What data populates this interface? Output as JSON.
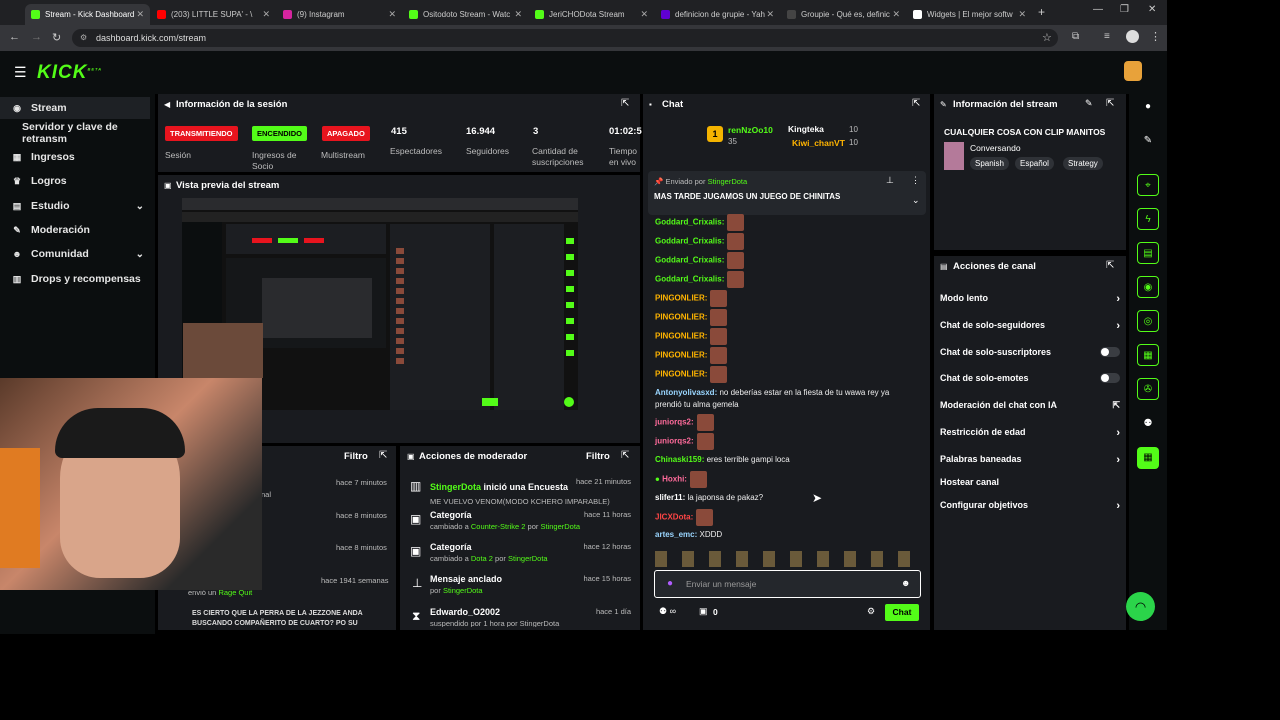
{
  "browser": {
    "tabs": [
      {
        "label": "Stream - Kick Dashboard",
        "color": "#53fc18"
      },
      {
        "label": "(203) LITTLE SUPA' - \\",
        "color": "#ff0000"
      },
      {
        "label": "(9) Instagram",
        "color": "#d6249f"
      },
      {
        "label": "Ositodoto Stream - Watc",
        "color": "#53fc18"
      },
      {
        "label": "JeriCHODota Stream",
        "color": "#53fc18"
      },
      {
        "label": "definicion de grupie - Yah",
        "color": "#6001d2"
      },
      {
        "label": "Groupie - Qué es, definic",
        "color": "#333"
      },
      {
        "label": "Widgets | El mejor softw",
        "color": "#fff"
      }
    ],
    "url": "dashboard.kick.com/stream"
  },
  "brand": {
    "logo": "KICK",
    "beta": "BETA"
  },
  "sidebar": {
    "items": [
      {
        "label": "Stream",
        "icon": "stream-icon"
      },
      {
        "label": "Servidor y clave de retransm"
      },
      {
        "label": "Ingresos",
        "icon": "revenue-icon"
      },
      {
        "label": "Logros",
        "icon": "trophy-icon"
      },
      {
        "label": "Estudio",
        "icon": "studio-icon"
      },
      {
        "label": "Moderación",
        "icon": "wrench-icon"
      },
      {
        "label": "Comunidad",
        "icon": "community-icon"
      },
      {
        "label": "Drops y recompensas",
        "icon": "drops-icon"
      }
    ]
  },
  "session": {
    "title": "Información de la sesión",
    "status": [
      {
        "label": "TRANSMITIENDO",
        "sub": "Sesión"
      },
      {
        "label": "ENCENDIDO",
        "sub": "Ingresos de Socio"
      },
      {
        "label": "APAGADO",
        "sub": "Multistream"
      }
    ],
    "stats": [
      {
        "value": "415",
        "label": "Espectadores"
      },
      {
        "value": "16.944",
        "label": "Seguidores"
      },
      {
        "value": "3",
        "label": "Cantidad de suscripciones"
      },
      {
        "value": "01:02:5",
        "label": "Tiempo en vivo"
      }
    ]
  },
  "preview": {
    "title": "Vista previa del stream"
  },
  "activity": {
    "filter": "Filtro",
    "times": [
      "hace 7 minutos",
      "hace 8 minutos",
      "hace 8 minutos",
      "hace 1941 semanas"
    ],
    "frag1": "nal",
    "raid": "envió un",
    "raid_name": "Rage Quit",
    "message": "ES CIERTO QUE LA PERRA DE LA JEZZONE ANDA BUSCANDO COMPAÑERITO DE CUARTO? PO SU"
  },
  "mod": {
    "title": "Acciones de moderador",
    "filter": "Filtro",
    "rows": [
      {
        "title_user": "StingerDota",
        "title": " inició una Encuesta",
        "sub": "ME VUELVO VENOM(MODO KCHERO IMPARABLE)",
        "time": "hace 21 minutos"
      },
      {
        "title": "Categoría",
        "sub_a": "cambiado a ",
        "sub_b": "Counter-Strike 2",
        "sub_c": " por ",
        "sub_d": "StingerDota",
        "time": "hace 11 horas"
      },
      {
        "title": "Categoría",
        "sub_a": "cambiado a ",
        "sub_b": "Dota 2",
        "sub_c": " por ",
        "sub_d": "StingerDota",
        "time": "hace 12 horas"
      },
      {
        "title": "Mensaje anclado",
        "sub_a": "por ",
        "sub_b": "StingerDota",
        "time": "hace 15 horas"
      },
      {
        "title": "Edwardo_O2002",
        "sub": "suspendido por 1 hora por StingerDota",
        "time": "hace 1 día"
      }
    ]
  },
  "chat": {
    "title": "Chat",
    "top": {
      "rank": "1",
      "user": "renNzOo10",
      "count": "35",
      "u2": "Kingteka",
      "u2n": "10",
      "u3": "Kiwi_chanVT",
      "u3n": "10"
    },
    "pinned_by": "Enviado por",
    "pinned_user": "StingerDota",
    "pinned_msg": "MAS TARDE JUGAMOS UN JUEGO DE CHINITAS",
    "lines": [
      {
        "user": "Goddard_Crixalis:",
        "color": "#53fc18",
        "text": ""
      },
      {
        "user": "Goddard_Crixalis:",
        "color": "#53fc18",
        "text": ""
      },
      {
        "user": "Goddard_Crixalis:",
        "color": "#53fc18",
        "text": ""
      },
      {
        "user": "Goddard_Crixalis:",
        "color": "#53fc18",
        "text": ""
      },
      {
        "user": "PINGONLIER:",
        "color": "#ffb400",
        "text": ""
      },
      {
        "user": "PINGONLIER:",
        "color": "#ffb400",
        "text": ""
      },
      {
        "user": "PINGONLIER:",
        "color": "#ffb400",
        "text": ""
      },
      {
        "user": "PINGONLIER:",
        "color": "#ffb400",
        "text": ""
      },
      {
        "user": "PINGONLIER:",
        "color": "#ffb400",
        "text": ""
      }
    ],
    "antony": {
      "user": "Antonyolivasxd:",
      "msg1": "no deberías estar en la fiesta de tu wawa rey ya",
      "msg2": "prendió tu alma gemela"
    },
    "jun1": "juniorqs2:",
    "jun2": "juniorqs2:",
    "chin": {
      "user": "Chinaski159:",
      "msg": "eres terrible gampi loca"
    },
    "hoxhi": "Hoxhi:",
    "slifer": {
      "user": "slifer11:",
      "msg": "la japonsa de pakaz?"
    },
    "jicx": "JICXDota:",
    "artes": {
      "user": "artes_emc:",
      "msg": "XDDD"
    },
    "placeholder": "Enviar un mensaje",
    "count": "0",
    "send": "Chat"
  },
  "stream_info": {
    "title": "Información del stream",
    "stream_title": "CUALQUIER COSA CON CLIP MANITOS",
    "category": "Conversando",
    "tags": [
      "Spanish",
      "Español",
      "Strategy"
    ]
  },
  "channel_actions": {
    "title": "Acciones de canal",
    "items": [
      {
        "label": "Modo lento",
        "type": "chevron"
      },
      {
        "label": "Chat de solo-seguidores",
        "type": "chevron"
      },
      {
        "label": "Chat de solo-suscriptores",
        "type": "toggle"
      },
      {
        "label": "Chat de solo-emotes",
        "type": "toggle"
      },
      {
        "label": "Moderación del chat con IA",
        "type": "external"
      },
      {
        "label": "Restricción de edad",
        "type": "chevron"
      },
      {
        "label": "Palabras baneadas",
        "type": "chevron"
      },
      {
        "label": "Hostear canal",
        "type": "none"
      },
      {
        "label": "Configurar objetivos",
        "type": "chevron"
      }
    ]
  }
}
